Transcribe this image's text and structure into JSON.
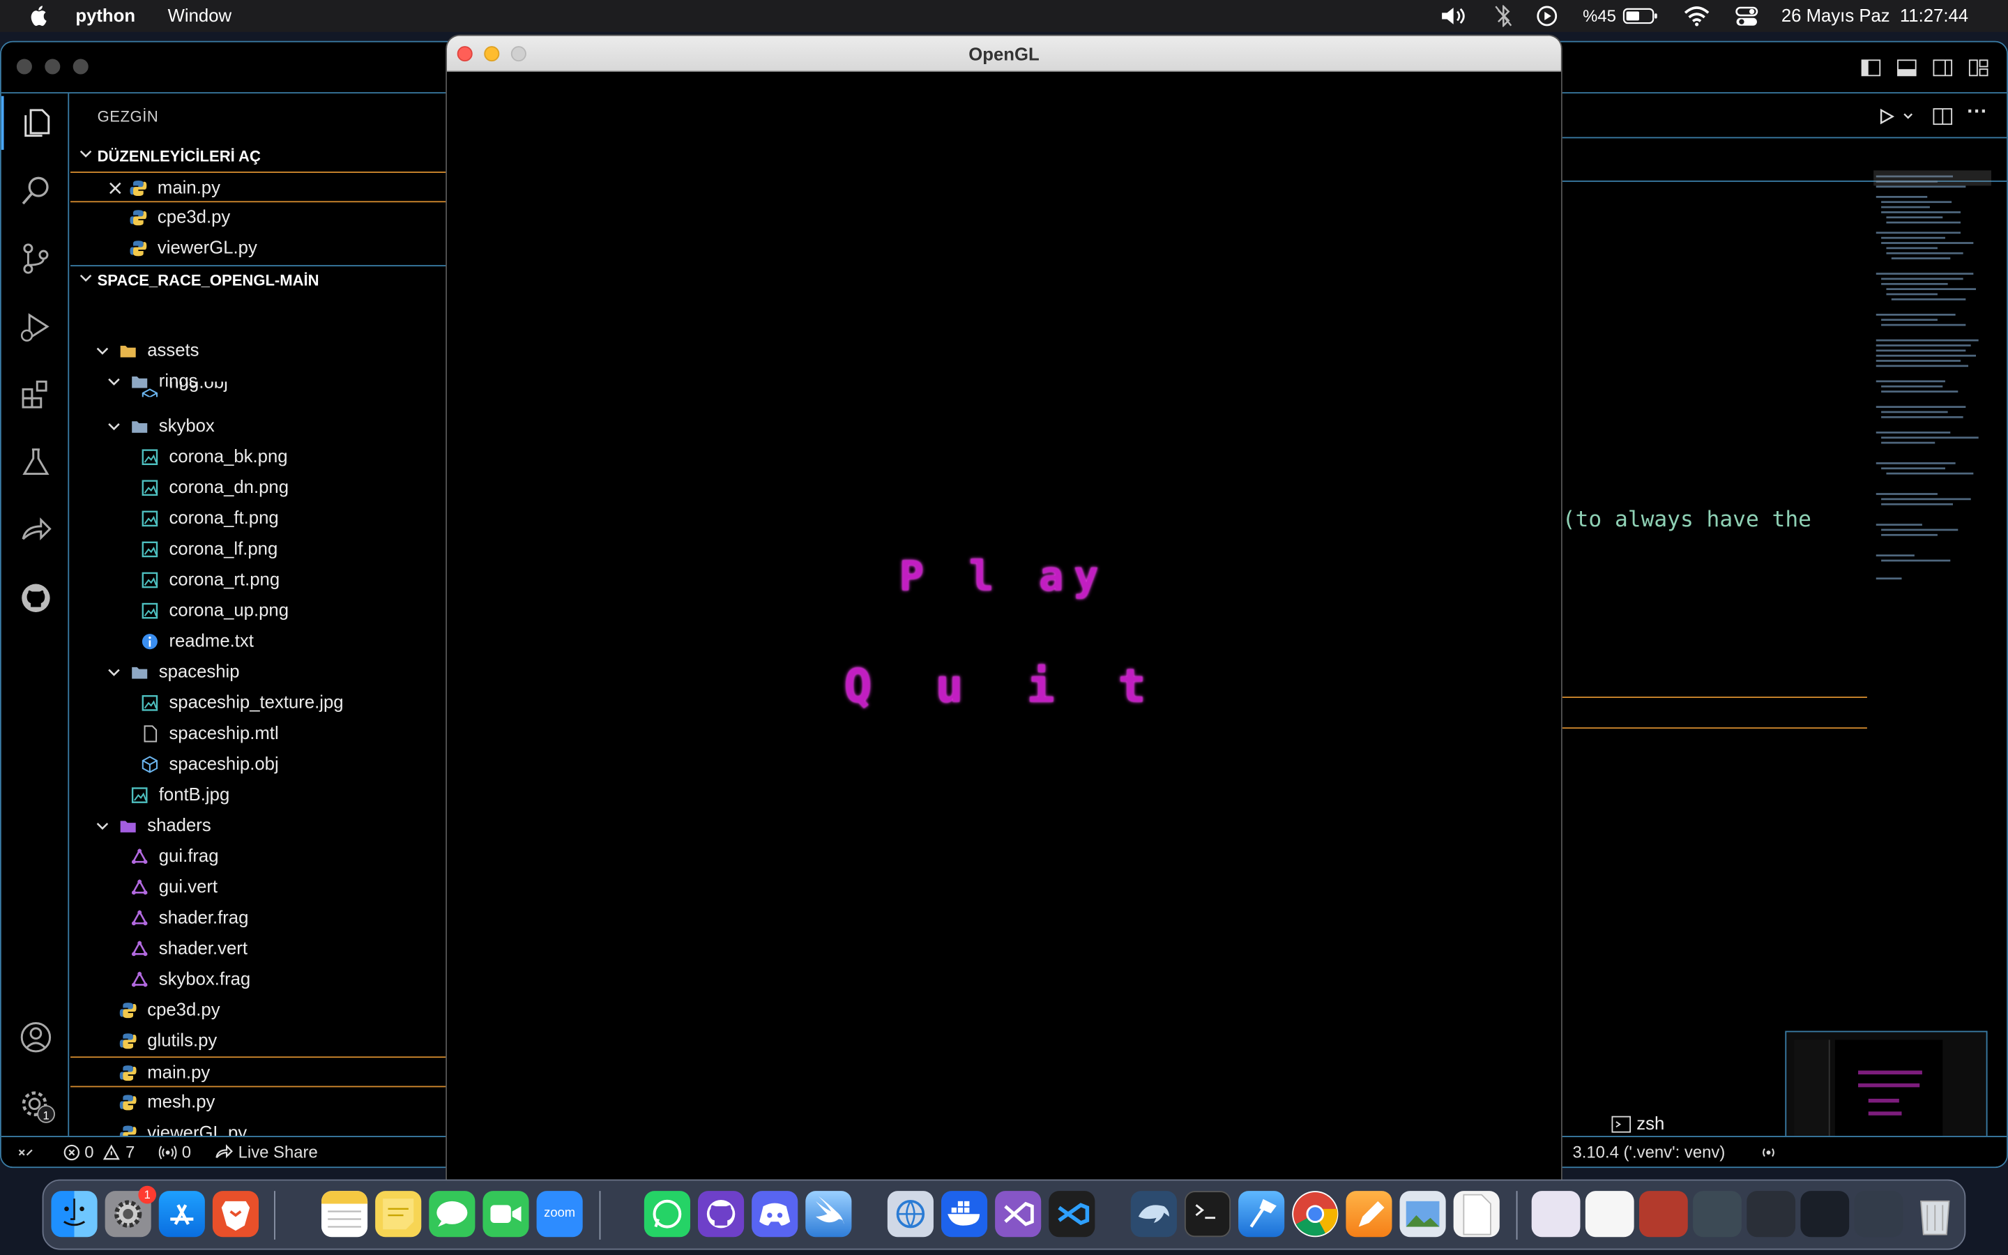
{
  "menubar": {
    "app_name": "python",
    "menu_window": "Window",
    "battery": "%45",
    "datetime": "26 Mayıs Paz  11:27:44",
    "icons": [
      "apple-icon",
      "volume-icon",
      "bluetooth-off-icon",
      "play-circle-icon",
      "battery-icon",
      "wifi-icon",
      "control-center-icon"
    ]
  },
  "gl_window": {
    "title": "OpenGL",
    "menu_play": "P l ay",
    "menu_quit": "Q u i t"
  },
  "sidebar": {
    "title": "GEZGİN",
    "open_editors_title": "DÜZENLEYİCİLERİ AÇ",
    "open_editors": [
      "main.py",
      "cpe3d.py",
      "viewerGL.py"
    ],
    "project_title": "SPACE_RACE_OPENGL-MAİN",
    "tree": {
      "assets": "assets",
      "rings": "rings",
      "ring_obj": "ring.obj",
      "skybox": "skybox",
      "skybox_files": [
        "corona_bk.png",
        "corona_dn.png",
        "corona_ft.png",
        "corona_lf.png",
        "corona_rt.png",
        "corona_up.png",
        "readme.txt"
      ],
      "spaceship": "spaceship",
      "spaceship_files": [
        "spaceship_texture.jpg",
        "spaceship.mtl",
        "spaceship.obj"
      ],
      "fontB": "fontB.jpg",
      "shaders": "shaders",
      "shader_files": [
        "gui.frag",
        "gui.vert",
        "shader.frag",
        "shader.vert",
        "skybox.frag"
      ],
      "root_files": [
        "cpe3d.py",
        "glutils.py",
        "main.py",
        "mesh.py",
        "viewerGL.py"
      ]
    }
  },
  "statusbar": {
    "errors": "0",
    "warnings": "7",
    "ports": "0",
    "live_share": "Live Share",
    "python_env": "3.10.4 ('.venv': venv)"
  },
  "editor": {
    "visible_code": "(to always have the",
    "terminal_label": "zsh"
  },
  "settings_badge": "1",
  "dock": {
    "apps": [
      "Finder",
      "System Settings",
      "App Store",
      "Brave",
      "Notes",
      "Stickies",
      "Messages",
      "FaceTime",
      "Zoom",
      "WhatsApp",
      "GitHub Desktop",
      "Discord",
      "Swift Playgrounds",
      "Network Utility",
      "Docker",
      "Visual Studio",
      "VS Code",
      "MySQL Workbench",
      "Terminal",
      "Xcode",
      "Chrome",
      "Pages",
      "Preview",
      "TextEdit",
      "Trash"
    ],
    "zoom_label": "zoom",
    "settings_badge": "1"
  }
}
